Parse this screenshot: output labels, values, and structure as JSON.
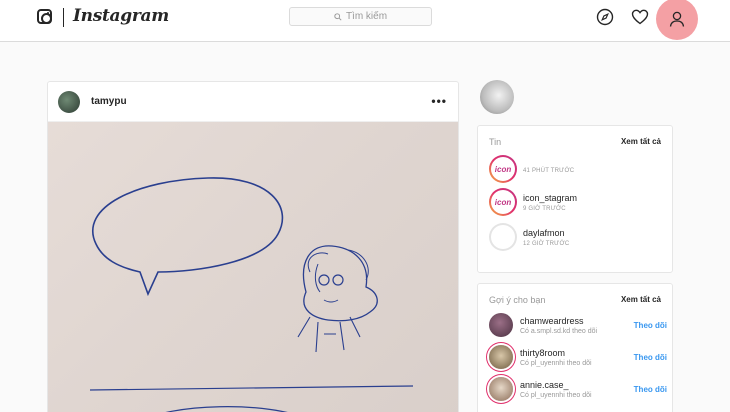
{
  "header": {
    "brand": "Instagram",
    "search_placeholder": "Tìm kiếm"
  },
  "post": {
    "username": "tamypu",
    "more": "•••"
  },
  "stories": {
    "title": "Tin",
    "see_all": "Xem tất cả",
    "items": [
      {
        "name": "",
        "time": "41 PHÚT TRƯỚC",
        "avatar_text": "icon"
      },
      {
        "name": "icon_stagram",
        "time": "9 GIỜ TRƯỚC",
        "avatar_text": "icon"
      },
      {
        "name": "daylafmon",
        "time": "12 GIỜ TRƯỚC",
        "avatar_text": ""
      }
    ]
  },
  "suggestions": {
    "title": "Gợi ý cho bạn",
    "see_all": "Xem tất cả",
    "items": [
      {
        "name": "chamweardress",
        "sub": "Có a.smpl.sd.kd theo dõi",
        "follow": "Theo dõi"
      },
      {
        "name": "thirty8room",
        "sub": "Có pl_uyennhi theo dõi",
        "follow": "Theo dõi"
      },
      {
        "name": "annie.case_",
        "sub": "Có pl_uyennhi theo dõi",
        "follow": "Theo dõi"
      }
    ]
  },
  "colors": {
    "link": "#3897f0",
    "profile_highlight": "#f4a0a4",
    "border": "#dbdbdb"
  }
}
